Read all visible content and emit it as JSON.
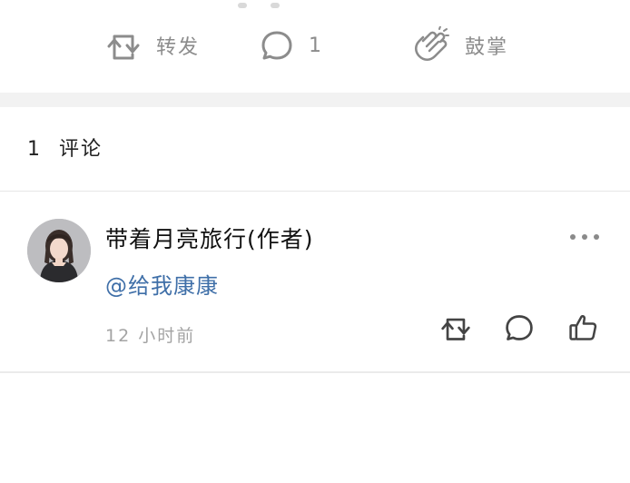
{
  "actions": {
    "repost_label": "转发",
    "comment_count": "1",
    "like_label": "鼓掌"
  },
  "comments_header": {
    "count": "1",
    "label": "评论"
  },
  "comments": [
    {
      "author": "带着月亮旅行(作者)",
      "mention": "@给我康康",
      "time": "12 小时前"
    }
  ],
  "colors": {
    "action_gray": "#8c8c8c",
    "mention_blue": "#3f6fa8",
    "divider": "#e6e6e6",
    "band": "#f2f2f2"
  }
}
